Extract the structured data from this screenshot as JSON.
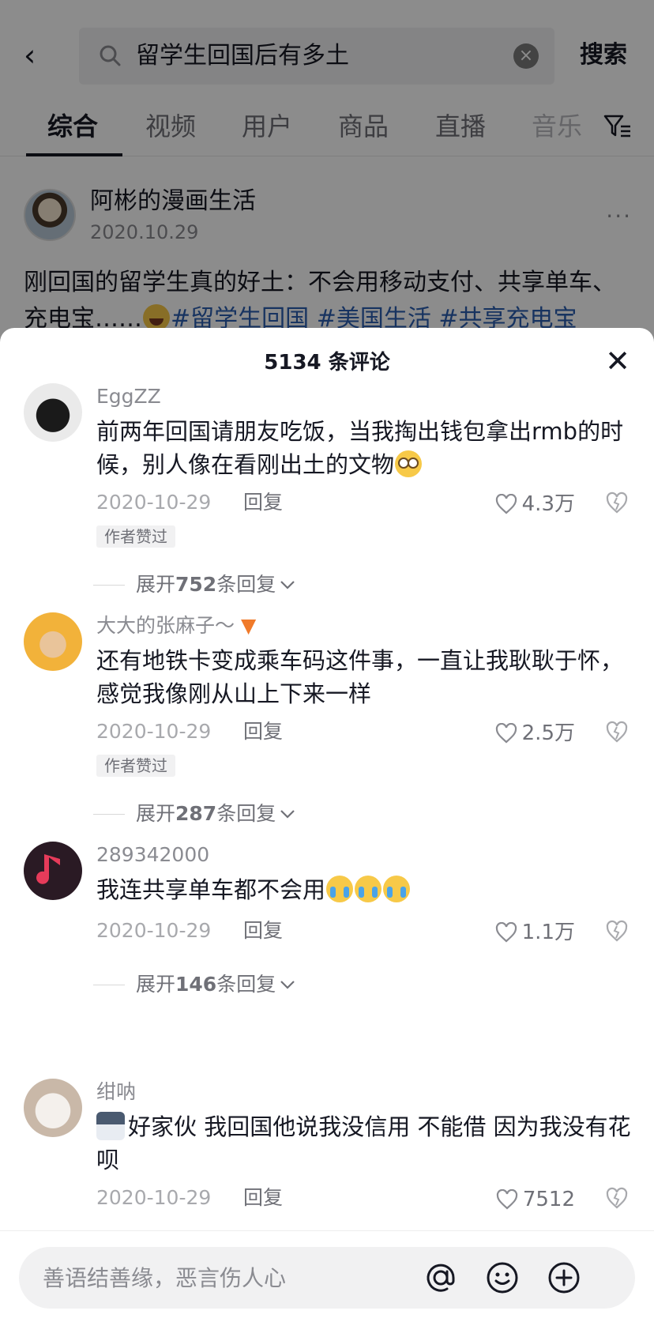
{
  "search": {
    "back_glyph": "‹",
    "query": "留学生回国后有多土",
    "clear_glyph": "×",
    "submit_label": "搜索"
  },
  "tabs": [
    {
      "label": "综合",
      "active": true
    },
    {
      "label": "视频",
      "active": false
    },
    {
      "label": "用户",
      "active": false
    },
    {
      "label": "商品",
      "active": false
    },
    {
      "label": "直播",
      "active": false
    },
    {
      "label": "音乐",
      "active": false
    }
  ],
  "post": {
    "author": "阿彬的漫画生活",
    "date": "2020.10.29",
    "more_glyph": "···",
    "text_before": "刚回国的留学生真的好土：不会用移动支付、共享单车、充电宝……",
    "hashtags": [
      "#留学生回国",
      "#美国生活",
      "#共享充电宝"
    ]
  },
  "sheet": {
    "title": "5134 条评论",
    "close_glyph": "✕"
  },
  "comments": [
    {
      "user": "EggZZ",
      "text": "前两年回国请朋友吃饭，当我掏出钱包拿出rmb的时候，别人像在看刚出土的文物",
      "date": "2020-10-29",
      "reply_label": "回复",
      "likes": "4.3万",
      "badge": "作者赞过",
      "expand_prefix": "展开",
      "expand_count": "752",
      "expand_suffix": "条回复"
    },
    {
      "user": "大大的张麻子～",
      "text": "还有地铁卡变成乘车码这件事，一直让我耿耿于怀，感觉我像刚从山上下来一样",
      "date": "2020-10-29",
      "reply_label": "回复",
      "likes": "2.5万",
      "badge": "作者赞过",
      "expand_prefix": "展开",
      "expand_count": "287",
      "expand_suffix": "条回复"
    },
    {
      "user": "289342000",
      "text": "我连共享单车都不会用",
      "date": "2020-10-29",
      "reply_label": "回复",
      "likes": "1.1万",
      "expand_prefix": "展开",
      "expand_count": "146",
      "expand_suffix": "条回复"
    },
    {
      "user": "绀呐",
      "text": "好家伙 我回国他说我没信用 不能借 因为我没有花呗",
      "date": "2020-10-29",
      "reply_label": "回复",
      "likes": "7512"
    }
  ],
  "input": {
    "placeholder": "善语结善缘，恶言伤人心"
  },
  "icons": {
    "search": "search-icon",
    "filter": "filter-icon",
    "heart": "heart-icon",
    "dislike": "broken-heart-icon",
    "at": "at-icon",
    "emoji": "smiley-icon",
    "add": "plus-circle-icon"
  }
}
